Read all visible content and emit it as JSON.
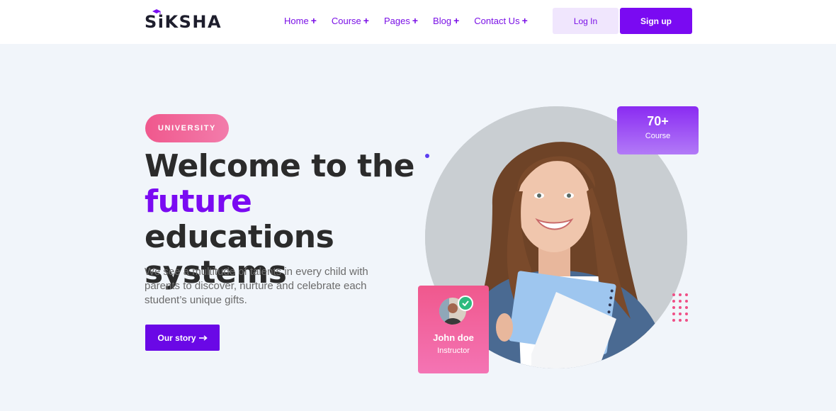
{
  "brand": {
    "logo_text": "SiKSHA",
    "accent": "#7a0af2",
    "pink": "#f0588d"
  },
  "nav": {
    "items": [
      {
        "label": "Home"
      },
      {
        "label": "Course"
      },
      {
        "label": "Pages"
      },
      {
        "label": "Blog"
      },
      {
        "label": "Contact Us"
      }
    ],
    "expand_symbol": "+"
  },
  "auth": {
    "login_label": "Log In",
    "signup_label": "Sign up"
  },
  "hero": {
    "badge": "UNIVERSITY",
    "headline_1": "Welcome to the",
    "headline_accent": "future",
    "headline_2": " educations",
    "headline_3": "systems",
    "description": "We see a multitude of talents in every child with parents to discover, nurture and celebrate each student’s unique gifts.",
    "cta_label": "Our story",
    "cta_icon": "arrow-right-icon"
  },
  "stats": {
    "course_count": "70+",
    "course_label": "Course"
  },
  "instructor": {
    "name": "John doe",
    "role": "Instructor",
    "verified_icon": "check-icon"
  }
}
